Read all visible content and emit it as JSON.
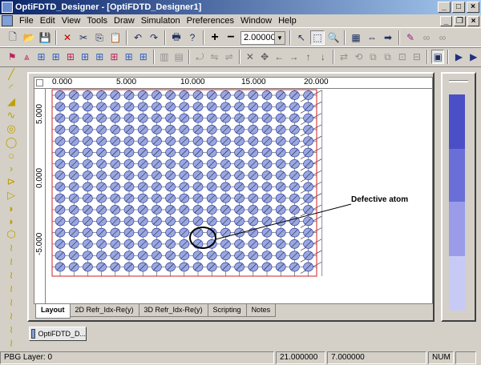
{
  "window": {
    "title": "OptiFDTD_Designer - [OptiFDTD_Designer1]"
  },
  "menu": [
    "File",
    "Edit",
    "View",
    "Tools",
    "Draw",
    "Simulaton",
    "Preferences",
    "Window",
    "Help"
  ],
  "toolbar": {
    "zoom_value": "2.00000"
  },
  "ruler": {
    "h_labels": [
      "0.000",
      "5.000",
      "10.000",
      "15.000",
      "20.000"
    ],
    "v_labels": [
      "5.000",
      "0.000",
      "-5.000"
    ]
  },
  "canvas": {
    "annotation": "Defective atom"
  },
  "tabs": [
    "Layout",
    "2D Refr_Idx-Re(y)",
    "3D Refr_Idx-Re(y)",
    "Scripting",
    "Notes"
  ],
  "mdi_tab": "OptiFDTD_D...",
  "status": {
    "layer": "PBG Layer: 0",
    "x": "21.000000",
    "y": "7.000000",
    "num": "NUM"
  },
  "colors": {
    "atom_fill": "#9aa8e0",
    "atom_stroke": "#3040a0",
    "wafer_border": "#cc2020",
    "grid": "#202040"
  }
}
